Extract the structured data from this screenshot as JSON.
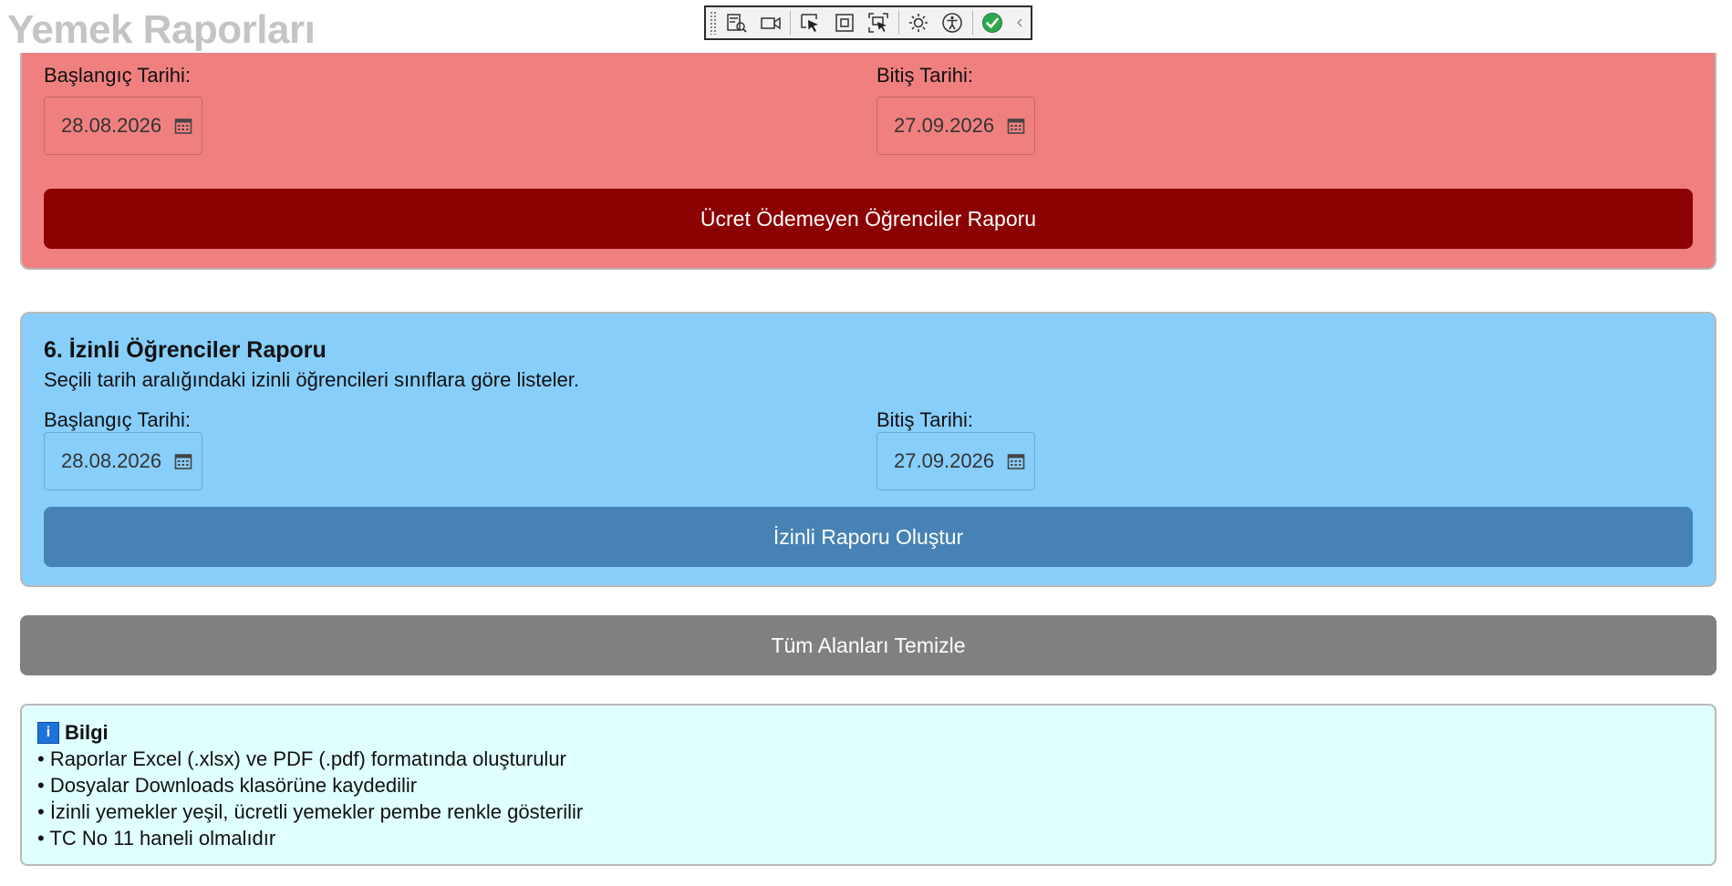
{
  "page": {
    "title": "Yemek Raporları"
  },
  "toolbar": {
    "icons": [
      "live-visual-tree-icon",
      "record-icon",
      "select-element-icon",
      "display-layout-adorners-icon",
      "track-focus-icon",
      "hot-reload-icon",
      "accessibility-icon",
      "binding-status-check-icon",
      "collapse-chevron-icon"
    ]
  },
  "unpaid_report": {
    "start_label": "Başlangıç Tarihi:",
    "start_date": "28.08.2026",
    "end_label": "Bitiş Tarihi:",
    "end_date": "27.09.2026",
    "button_label": "Ücret Ödemeyen Öğrenciler Raporu"
  },
  "permitted_report": {
    "heading": "6. İzinli Öğrenciler Raporu",
    "description": "Seçili tarih aralığındaki izinli öğrencileri sınıflara göre listeler.",
    "start_label": "Başlangıç Tarihi:",
    "start_date": "28.08.2026",
    "end_label": "Bitiş Tarihi:",
    "end_date": "27.09.2026",
    "button_label": "İzinli Raporu Oluştur"
  },
  "clear_button": {
    "label": "Tüm Alanları Temizle"
  },
  "info": {
    "icon_letter": "i",
    "title": "Bilgi",
    "lines": [
      "• Raporlar Excel (.xlsx) ve PDF (.pdf) formatında oluşturulur",
      "• Dosyalar Downloads klasörüne kaydedilir",
      "• İzinli yemekler yeşil, ücretli yemekler pembe renkle gösterilir",
      "• TC No 11 haneli olmalıdır"
    ]
  },
  "colors": {
    "unpaid_panel": "#f08080",
    "unpaid_button": "#8b0000",
    "permitted_panel": "#87cefa",
    "permitted_button": "#4682b4",
    "clear_button": "#808080",
    "info_panel": "#e0ffff"
  }
}
